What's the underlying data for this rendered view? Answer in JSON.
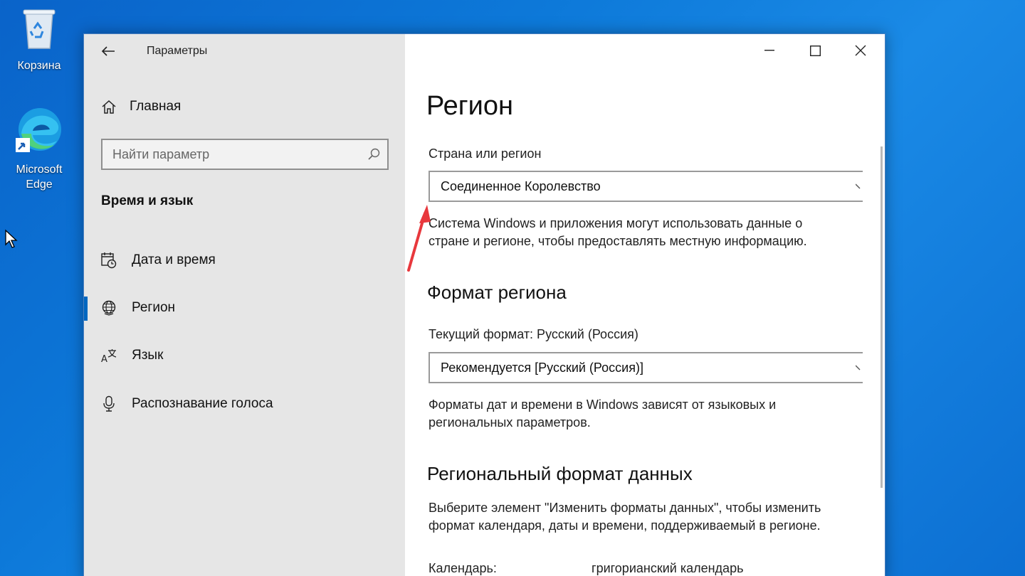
{
  "desktop": {
    "recycle_bin_label": "Корзина",
    "edge_label_line1": "Microsoft",
    "edge_label_line2": "Edge"
  },
  "window": {
    "app_title": "Параметры",
    "nav": {
      "home_label": "Главная",
      "search_placeholder": "Найти параметр",
      "section_title": "Время и язык",
      "items": [
        {
          "label": "Дата и время",
          "icon": "calendar-clock-icon",
          "active": false
        },
        {
          "label": "Регион",
          "icon": "globe-icon",
          "active": true
        },
        {
          "label": "Язык",
          "icon": "language-icon",
          "active": false
        },
        {
          "label": "Распознавание голоса",
          "icon": "microphone-icon",
          "active": false
        }
      ]
    },
    "content": {
      "page_title": "Регион",
      "country_label": "Страна или регион",
      "country_value": "Соединенное Королевство",
      "country_desc_line1": "Система Windows и приложения могут использовать данные о",
      "country_desc_line2": "стране и регионе, чтобы предоставлять местную информацию.",
      "format_heading": "Формат региона",
      "current_format_label": "Текущий формат: Русский (Россия)",
      "format_value": "Рекомендуется [Русский (Россия)]",
      "format_desc_line1": "Форматы дат и времени в Windows зависят от языковых и",
      "format_desc_line2": "региональных параметров.",
      "regional_data_heading": "Региональный формат данных",
      "regional_desc_line1": "Выберите элемент \"Изменить форматы данных\", чтобы изменить",
      "regional_desc_line2": "формат календаря, даты и времени, поддерживаемый в регионе.",
      "calendar_label": "Календарь:",
      "calendar_value": "григорианский календарь"
    }
  },
  "colors": {
    "accent": "#0067c0",
    "annotation_arrow": "#e8383d",
    "desktop_blue": "#0d79d9"
  }
}
